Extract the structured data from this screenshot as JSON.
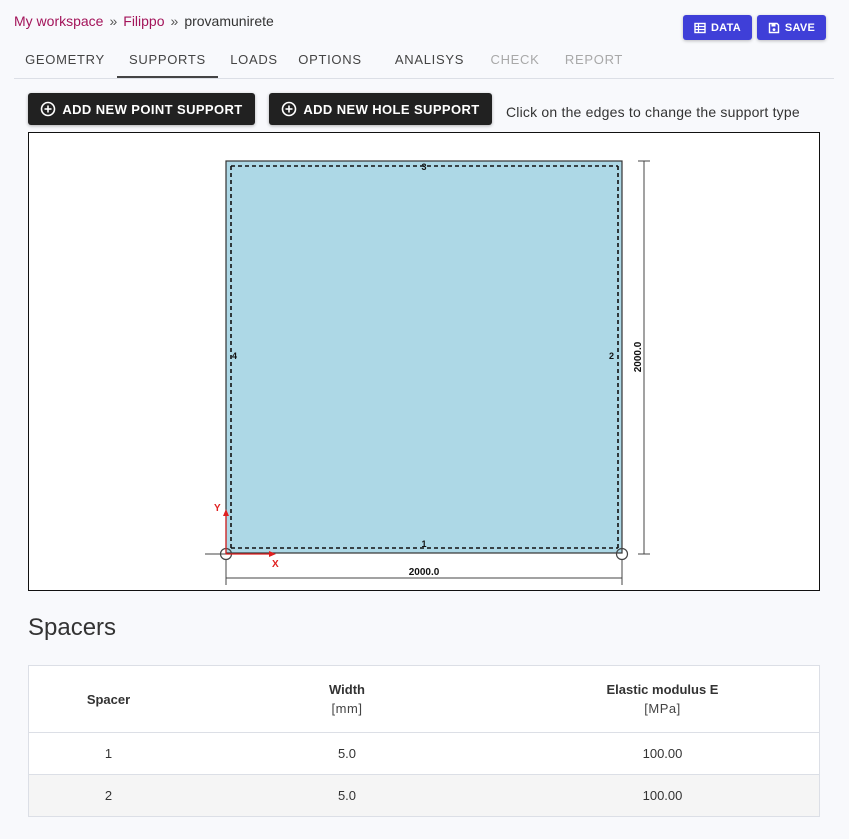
{
  "breadcrumb": {
    "workspace": "My workspace",
    "user": "Filippo",
    "project": "provamunirete",
    "separator": "»"
  },
  "toolbar": {
    "data_label": "DATA",
    "save_label": "SAVE"
  },
  "tabs": [
    {
      "label": "GEOMETRY",
      "state": "normal"
    },
    {
      "label": "SUPPORTS",
      "state": "active"
    },
    {
      "label": "LOADS",
      "state": "normal"
    },
    {
      "label": "OPTIONS",
      "state": "normal"
    },
    {
      "label": "ANALISYS",
      "state": "normal"
    },
    {
      "label": "CHECK",
      "state": "disabled"
    },
    {
      "label": "REPORT",
      "state": "disabled"
    }
  ],
  "actions": {
    "add_point_support": "ADD NEW POINT SUPPORT",
    "add_hole_support": "ADD NEW HOLE SUPPORT"
  },
  "hint": "Click on the edges to change the support type",
  "drawing": {
    "fill_color": "#add8e6",
    "axis_color": "#e02020",
    "edge_labels": [
      "1",
      "2",
      "3",
      "4"
    ],
    "width_dim": "2000.0",
    "height_dim": "2000.0",
    "axis_x": "X",
    "axis_y": "Y"
  },
  "spacers": {
    "title": "Spacers",
    "columns": [
      {
        "label": "Spacer",
        "unit": ""
      },
      {
        "label": "Width",
        "unit": "[mm]"
      },
      {
        "label": "Elastic modulus E",
        "unit": "[MPa]"
      }
    ],
    "rows": [
      {
        "spacer": "1",
        "width": "5.0",
        "modulus": "100.00"
      },
      {
        "spacer": "2",
        "width": "5.0",
        "modulus": "100.00"
      }
    ]
  },
  "colors": {
    "accent": "#3f3fd8",
    "breadcrumb_link": "#a3145a",
    "dark_button": "#212121"
  }
}
